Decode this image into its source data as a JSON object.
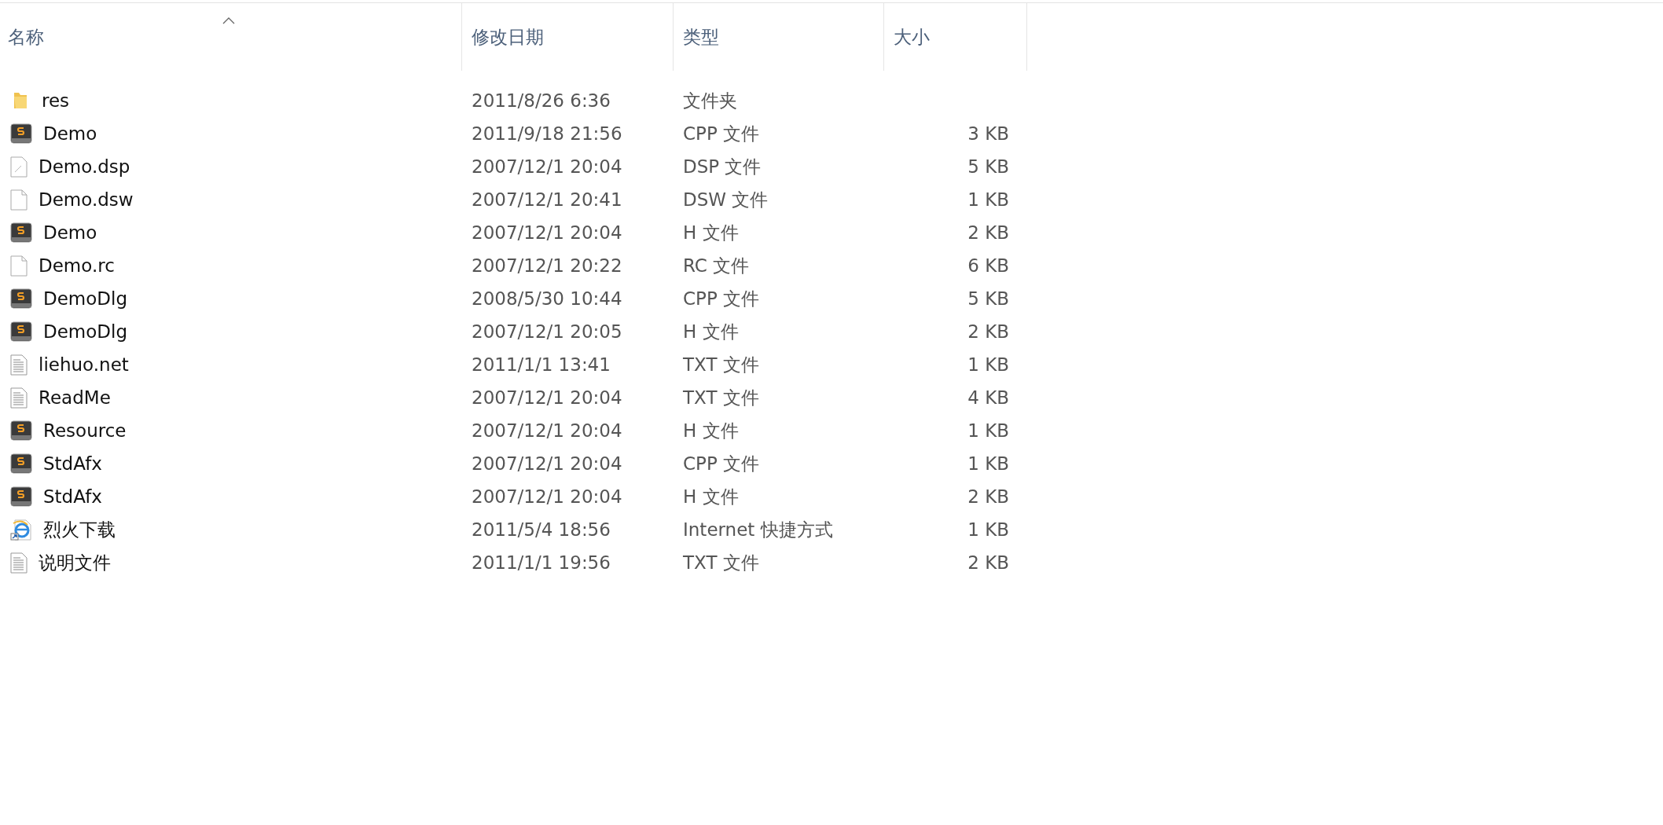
{
  "columns": [
    {
      "label": "名称",
      "sorted": true
    },
    {
      "label": "修改日期",
      "sorted": false
    },
    {
      "label": "类型",
      "sorted": false
    },
    {
      "label": "大小",
      "sorted": false
    }
  ],
  "rows": [
    {
      "kind": "folder",
      "name": "res",
      "date": "2011/8/26 6:36",
      "type": "文件夹",
      "size": ""
    },
    {
      "kind": "code",
      "name": "Demo",
      "date": "2011/9/18 21:56",
      "type": "CPP 文件",
      "size": "3 KB"
    },
    {
      "kind": "project",
      "name": "Demo.dsp",
      "date": "2007/12/1 20:04",
      "type": "DSP 文件",
      "size": "5 KB"
    },
    {
      "kind": "blank",
      "name": "Demo.dsw",
      "date": "2007/12/1 20:41",
      "type": "DSW 文件",
      "size": "1 KB"
    },
    {
      "kind": "code",
      "name": "Demo",
      "date": "2007/12/1 20:04",
      "type": "H 文件",
      "size": "2 KB"
    },
    {
      "kind": "blank",
      "name": "Demo.rc",
      "date": "2007/12/1 20:22",
      "type": "RC 文件",
      "size": "6 KB"
    },
    {
      "kind": "code",
      "name": "DemoDlg",
      "date": "2008/5/30 10:44",
      "type": "CPP 文件",
      "size": "5 KB"
    },
    {
      "kind": "code",
      "name": "DemoDlg",
      "date": "2007/12/1 20:05",
      "type": "H 文件",
      "size": "2 KB"
    },
    {
      "kind": "text",
      "name": "liehuo.net",
      "date": "2011/1/1 13:41",
      "type": "TXT 文件",
      "size": "1 KB"
    },
    {
      "kind": "text",
      "name": "ReadMe",
      "date": "2007/12/1 20:04",
      "type": "TXT 文件",
      "size": "4 KB"
    },
    {
      "kind": "code",
      "name": "Resource",
      "date": "2007/12/1 20:04",
      "type": "H 文件",
      "size": "1 KB"
    },
    {
      "kind": "code",
      "name": "StdAfx",
      "date": "2007/12/1 20:04",
      "type": "CPP 文件",
      "size": "1 KB"
    },
    {
      "kind": "code",
      "name": "StdAfx",
      "date": "2007/12/1 20:04",
      "type": "H 文件",
      "size": "2 KB"
    },
    {
      "kind": "shortcut",
      "name": "烈火下载",
      "date": "2011/5/4 18:56",
      "type": "Internet 快捷方式",
      "size": "1 KB"
    },
    {
      "kind": "text",
      "name": "说明文件",
      "date": "2011/1/1 19:56",
      "type": "TXT 文件",
      "size": "2 KB"
    }
  ]
}
